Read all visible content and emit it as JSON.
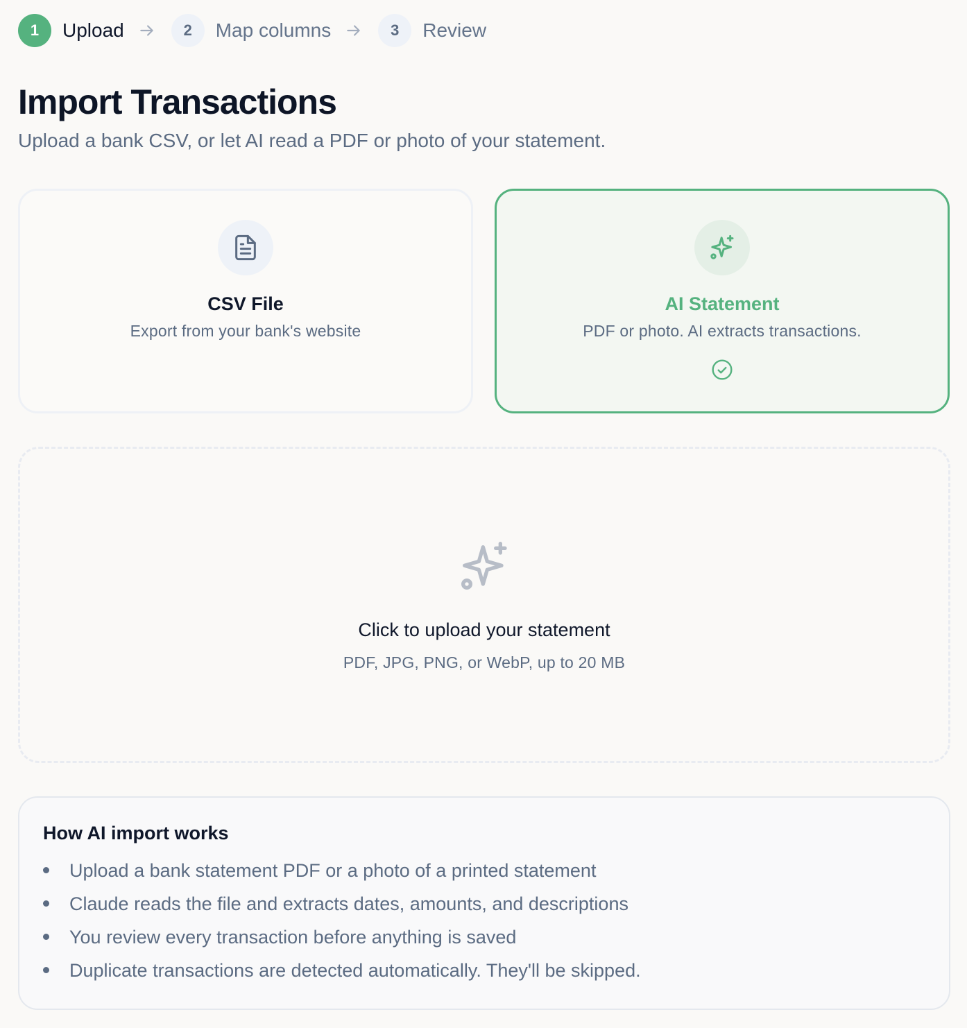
{
  "stepper": {
    "steps": [
      {
        "number": "1",
        "label": "Upload",
        "state": "active"
      },
      {
        "number": "2",
        "label": "Map columns",
        "state": "upcoming"
      },
      {
        "number": "3",
        "label": "Review",
        "state": "upcoming"
      }
    ],
    "separator_icon": "arrow-right-icon"
  },
  "header": {
    "title": "Import Transactions",
    "subtitle": "Upload a bank CSV, or let AI read a PDF or photo of your statement."
  },
  "options": {
    "csv": {
      "icon": "file-text-icon",
      "title": "CSV File",
      "description": "Export from your bank's website",
      "selected": false
    },
    "ai": {
      "icon": "sparkles-icon",
      "title": "AI Statement",
      "description": "PDF or photo. AI extracts transactions.",
      "selected": true,
      "selected_icon": "check-circle-icon"
    }
  },
  "dropzone": {
    "icon": "sparkles-icon",
    "title": "Click to upload your statement",
    "subtitle": "PDF, JPG, PNG, or WebP, up to 20 MB"
  },
  "info": {
    "title": "How AI import works",
    "items": [
      "Upload a bank statement PDF or a photo of a printed statement",
      "Claude reads the file and extracts dates, amounts, and descriptions",
      "You review every transaction before anything is saved",
      "Duplicate transactions are detected automatically. They'll be skipped."
    ]
  },
  "colors": {
    "accent": "#55b27f",
    "background": "#faf9f7",
    "muted_text": "#5b6b82",
    "heading_text": "#0d1526"
  }
}
